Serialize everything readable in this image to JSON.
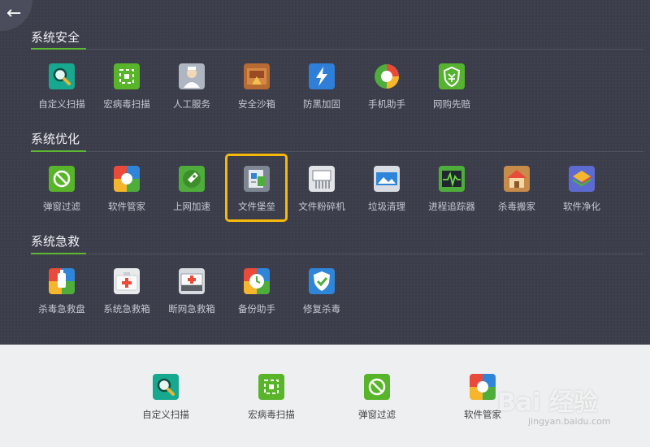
{
  "back_button": {
    "icon": "back-arrow-icon",
    "glyph": "←"
  },
  "sections": [
    {
      "title": "系统安全",
      "tools": [
        {
          "label": "自定义扫描",
          "icon": "magnifier-icon"
        },
        {
          "label": "宏病毒扫描",
          "icon": "macro-virus-scan-icon"
        },
        {
          "label": "人工服务",
          "icon": "support-person-icon"
        },
        {
          "label": "安全沙箱",
          "icon": "sandbox-icon"
        },
        {
          "label": "防黑加固",
          "icon": "lightning-shield-icon"
        },
        {
          "label": "手机助手",
          "icon": "phone-assistant-icon"
        },
        {
          "label": "网购先赔",
          "icon": "shopping-shield-icon"
        }
      ]
    },
    {
      "title": "系统优化",
      "tools": [
        {
          "label": "弹窗过滤",
          "icon": "popup-block-icon"
        },
        {
          "label": "软件管家",
          "icon": "software-manager-icon"
        },
        {
          "label": "上网加速",
          "icon": "rocket-icon"
        },
        {
          "label": "文件堡垒",
          "icon": "file-fortress-icon"
        },
        {
          "label": "文件粉碎机",
          "icon": "shredder-icon"
        },
        {
          "label": "垃圾清理",
          "icon": "cleanup-icon"
        },
        {
          "label": "进程追踪器",
          "icon": "process-tracker-icon"
        },
        {
          "label": "杀毒搬家",
          "icon": "house-move-icon"
        },
        {
          "label": "软件净化",
          "icon": "layers-icon"
        }
      ]
    },
    {
      "title": "系统急救",
      "tools": [
        {
          "label": "杀毒急救盘",
          "icon": "rescue-disk-icon"
        },
        {
          "label": "系统急救箱",
          "icon": "first-aid-kit-icon"
        },
        {
          "label": "断网急救箱",
          "icon": "offline-aid-kit-icon"
        },
        {
          "label": "备份助手",
          "icon": "backup-clock-icon"
        },
        {
          "label": "修复杀毒",
          "icon": "repair-shield-icon"
        }
      ]
    }
  ],
  "bottom_tools": [
    {
      "label": "自定义扫描",
      "icon": "magnifier-icon"
    },
    {
      "label": "宏病毒扫描",
      "icon": "macro-virus-scan-icon"
    },
    {
      "label": "弹窗过滤",
      "icon": "popup-block-icon"
    },
    {
      "label": "软件管家",
      "icon": "software-manager-icon"
    }
  ],
  "watermark": {
    "logo_text": "Bai 经验",
    "url": "jingyan.baidu.com"
  }
}
